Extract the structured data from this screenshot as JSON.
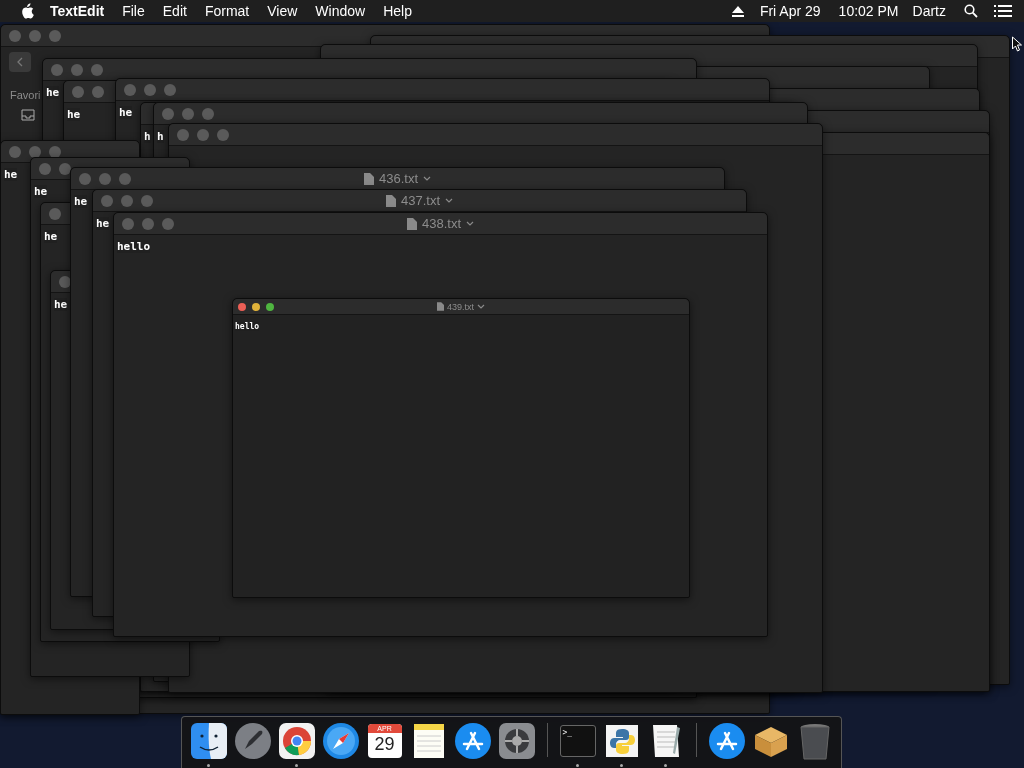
{
  "menu_bar": {
    "app_name": "TextEdit",
    "menus": [
      "File",
      "Edit",
      "Format",
      "View",
      "Window",
      "Help"
    ],
    "date": "Fri Apr 29",
    "time": "10:02 PM",
    "user": "Dartz"
  },
  "windows": [
    {
      "kind": "finder",
      "sidebar_label": "Favori"
    },
    {
      "kind": "document"
    },
    {
      "kind": "document"
    },
    {
      "kind": "document"
    },
    {
      "kind": "document",
      "text": "he"
    },
    {
      "kind": "document"
    },
    {
      "kind": "document",
      "text": "he"
    },
    {
      "kind": "document"
    },
    {
      "kind": "document",
      "text": "he"
    },
    {
      "kind": "document"
    },
    {
      "kind": "document",
      "text": "h"
    },
    {
      "kind": "document",
      "text": "h"
    },
    {
      "kind": "document"
    },
    {
      "kind": "document",
      "text": "he"
    },
    {
      "kind": "document",
      "text": "he"
    },
    {
      "kind": "document",
      "text": "he"
    },
    {
      "kind": "document",
      "text": "he"
    },
    {
      "kind": "document",
      "title": "436.txt",
      "text": "he"
    },
    {
      "kind": "document",
      "title": "437.txt",
      "text": "he"
    },
    {
      "kind": "document",
      "title": "438.txt",
      "text": "hello"
    },
    {
      "kind": "front",
      "title": "439.txt",
      "text": "hello"
    }
  ],
  "dock": [
    {
      "kind": "finder",
      "running": true
    },
    {
      "kind": "launchpad",
      "running": false
    },
    {
      "kind": "chrome",
      "running": true
    },
    {
      "kind": "safari",
      "running": false
    },
    {
      "kind": "calendar",
      "month": "APR",
      "day": "29",
      "running": false
    },
    {
      "kind": "notes",
      "running": false
    },
    {
      "kind": "appstore",
      "running": false
    },
    {
      "kind": "settings",
      "running": false
    },
    {
      "kind": "separator"
    },
    {
      "kind": "terminal",
      "label": ">_",
      "running": true
    },
    {
      "kind": "python",
      "running": true
    },
    {
      "kind": "textedit",
      "running": true
    },
    {
      "kind": "separator"
    },
    {
      "kind": "appstore",
      "running": false
    },
    {
      "kind": "package",
      "running": false
    },
    {
      "kind": "trash",
      "running": false
    }
  ]
}
